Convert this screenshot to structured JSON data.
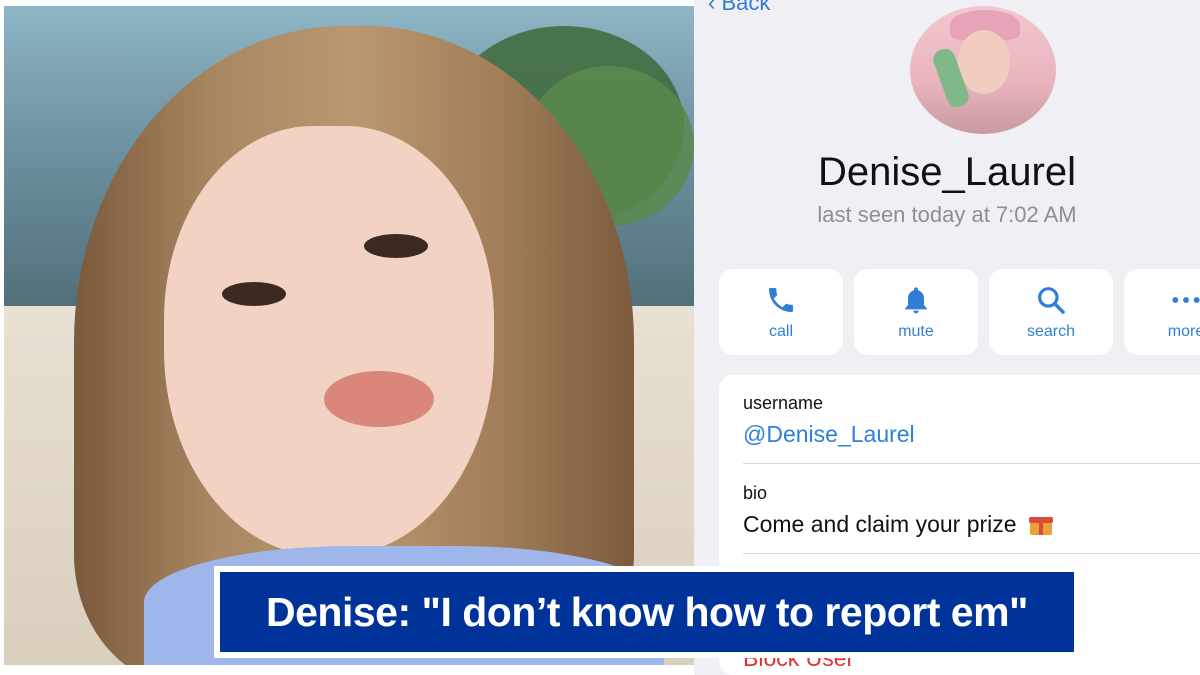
{
  "profile": {
    "back_label": "Back",
    "name": "Denise_Laurel",
    "last_seen": "last seen today at 7:02 AM",
    "actions": [
      {
        "label": "call",
        "icon": "phone-icon"
      },
      {
        "label": "mute",
        "icon": "bell-icon"
      },
      {
        "label": "search",
        "icon": "search-icon"
      },
      {
        "label": "more",
        "icon": "more-dots-icon"
      }
    ],
    "username_label": "username",
    "username_value": "@Denise_Laurel",
    "bio_label": "bio",
    "bio_value": "Come and claim your prize",
    "bio_emoji": "gift-icon",
    "block_label": "Block User"
  },
  "caption": {
    "text": "Denise: \"I don’t know how to report em\""
  },
  "colors": {
    "accent": "#2f7fd9",
    "banner_bg": "#003399",
    "panel_bg": "#efeff4"
  }
}
